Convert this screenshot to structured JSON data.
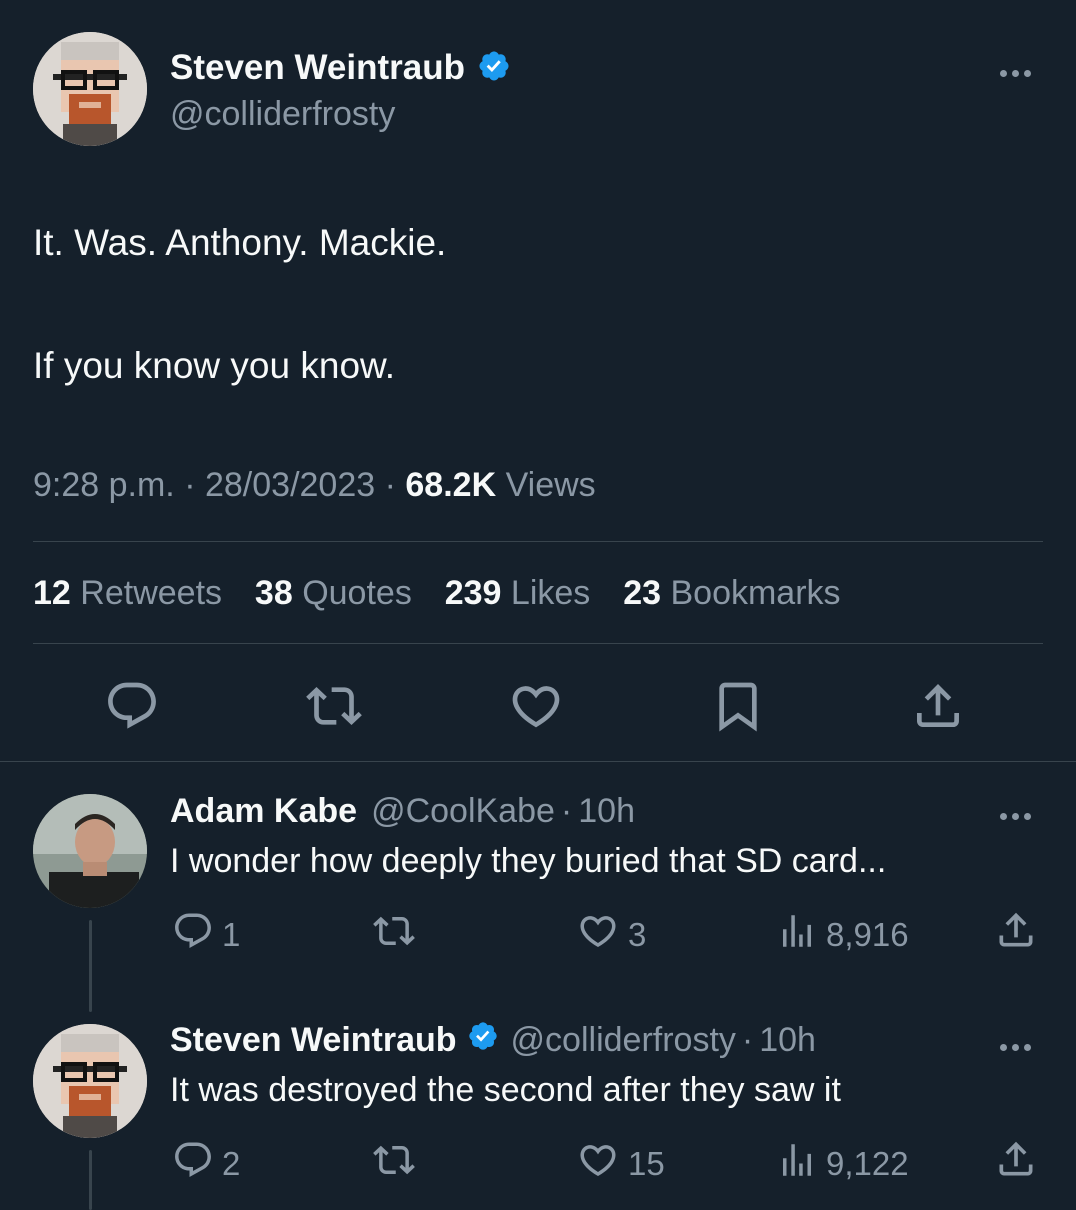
{
  "tweet": {
    "author_name": "Steven Weintraub",
    "author_handle": "@colliderfrosty",
    "text_line1": "It. Was. Anthony. Mackie.",
    "text_line2": "If you know you know.",
    "time": "9:28 p.m.",
    "date": "28/03/2023",
    "sep": "·",
    "views_count": "68.2K",
    "views_label": "Views",
    "stats": {
      "retweets_count": "12",
      "retweets_label": "Retweets",
      "quotes_count": "38",
      "quotes_label": "Quotes",
      "likes_count": "239",
      "likes_label": "Likes",
      "bookmarks_count": "23",
      "bookmarks_label": "Bookmarks"
    },
    "actions": [
      "reply-icon",
      "retweet-icon",
      "like-icon",
      "bookmark-icon",
      "share-icon"
    ]
  },
  "replies": [
    {
      "author_name": "Adam Kabe",
      "author_handle": "@CoolKabe",
      "time": "10h",
      "text": "I wonder how deeply they buried that SD card...",
      "reply_count": "1",
      "retweet_count": "",
      "like_count": "3",
      "view_count": "8,916"
    },
    {
      "author_name": "Steven Weintraub",
      "author_handle": "@colliderfrosty",
      "time": "10h",
      "text": "It was destroyed the second after they saw it",
      "reply_count": "2",
      "retweet_count": "",
      "like_count": "15",
      "view_count": "9,122"
    }
  ],
  "colors": {
    "background": "#15202b",
    "text": "#f7f9f9",
    "muted": "#8b98a5",
    "verified": "#1d9bf0",
    "divider": "#38444d"
  }
}
